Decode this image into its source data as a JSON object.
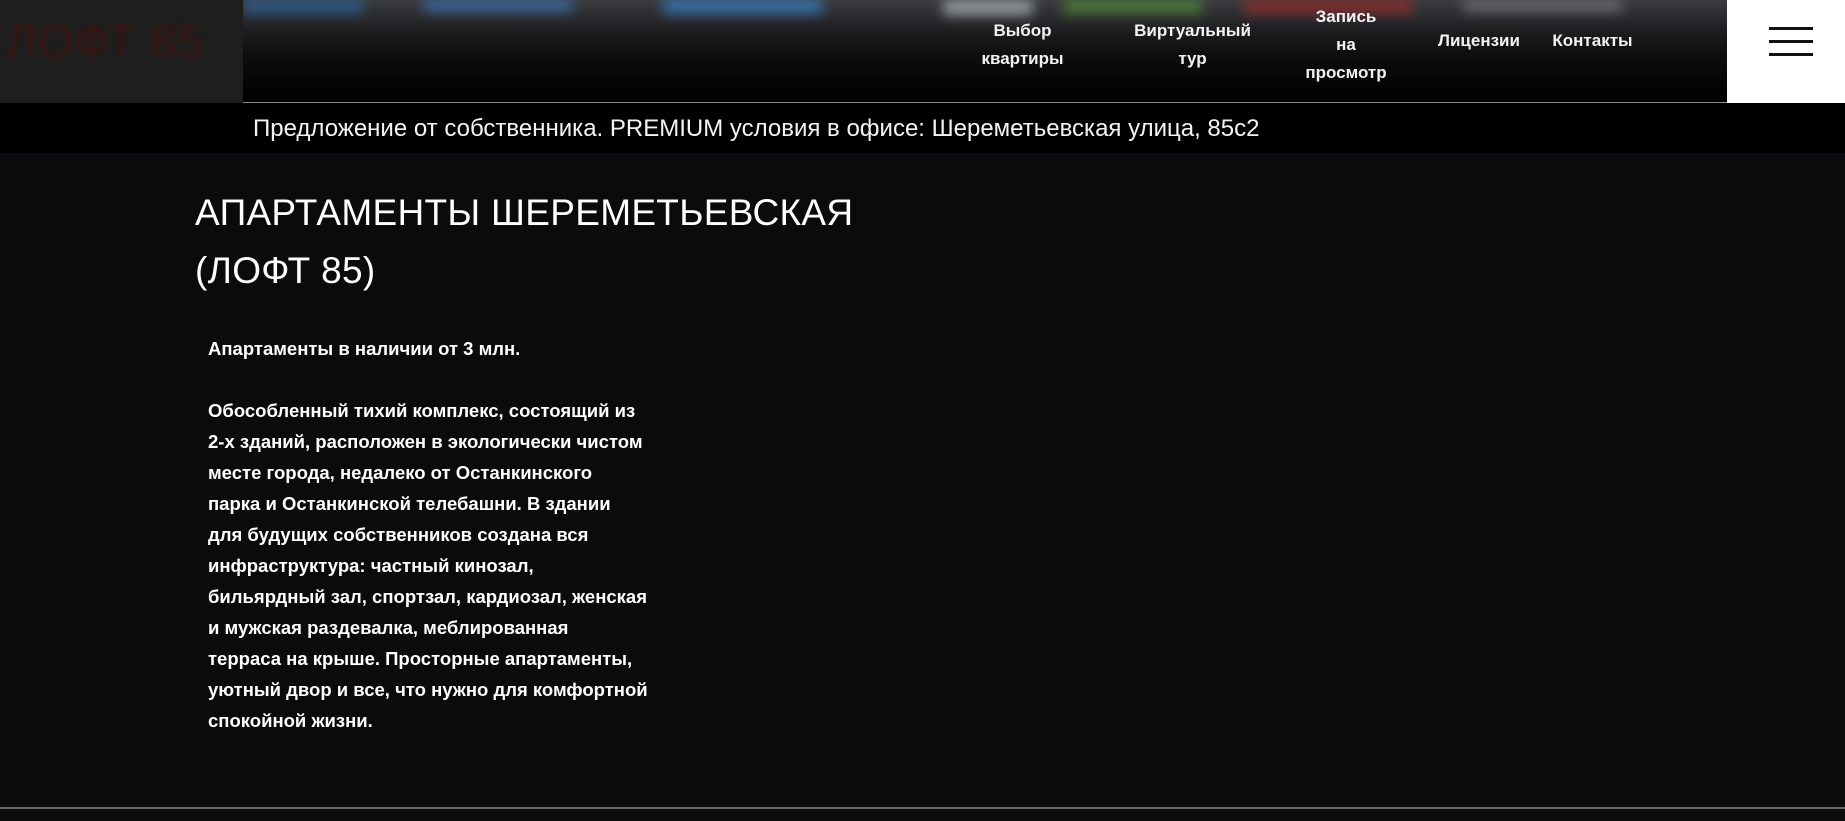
{
  "header": {
    "logo": "ЛОФТ 85",
    "nav": [
      {
        "lines": [
          "Выбор",
          "квартиры"
        ]
      },
      {
        "lines": [
          "Виртуальный",
          "тур"
        ]
      },
      {
        "lines": [
          "Запись",
          "на",
          "просмотр"
        ]
      },
      {
        "lines": [
          "Лицензии"
        ]
      },
      {
        "lines": [
          "Контакты"
        ]
      }
    ],
    "menu_icon": "hamburger-menu-icon"
  },
  "offer_bar": {
    "text": "Предложение от собственника. PREMIUM условия в офисе: Шереметьевская улица, 85с2"
  },
  "main": {
    "title_lines": [
      "АПАРТАМЕНТЫ ШЕРЕМЕТЬЕВСКАЯ",
      "(ЛОФТ 85)"
    ],
    "intro": "Апартаменты в наличии от 3 млн.",
    "description_lines": [
      "Обособленный тихий комплекс, состоящий из",
      "2-х зданий, расположен в экологически чистом",
      "месте города, недалеко от Останкинского",
      "парка и Останкинской телебашни. В здании",
      "для будущих собственников создана вся",
      "инфраструктура: частный кинозал,",
      "бильярдный зал, спортзал, кардиозал, женская",
      "и мужская раздевалка, меблированная",
      "терраса на крыше. Просторные апартаменты,",
      "уютный двор и все, что нужно для комфортной",
      "спокойной жизни."
    ]
  },
  "colors": {
    "page_background": "#0b0b0e",
    "text": "#ffffff",
    "menu_background": "#ffffff",
    "logo_box": "#1e1e1f"
  }
}
